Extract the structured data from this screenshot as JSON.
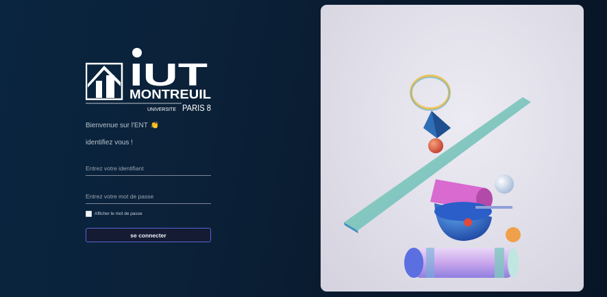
{
  "logo": {
    "name": "IUT",
    "city": "MONTREUIL",
    "university_label": "UNIVERSITE",
    "university_name": "PARIS 8"
  },
  "login": {
    "welcome_text": "Bienvenue sur l'ENT",
    "welcome_emoji": "👏",
    "subtitle": "identifiez vous !",
    "id_placeholder": "Entrez votre identifiant",
    "password_placeholder": "Entrez votre mot de passe",
    "show_password_label": "Afficher le mot de passe",
    "connect_label": "se connecter"
  },
  "colors": {
    "background": "#0a2540",
    "button_border": "#5b63d6",
    "button_bg": "#141b33"
  },
  "hero": {
    "image": "abstract-3d-shapes-illustration"
  }
}
